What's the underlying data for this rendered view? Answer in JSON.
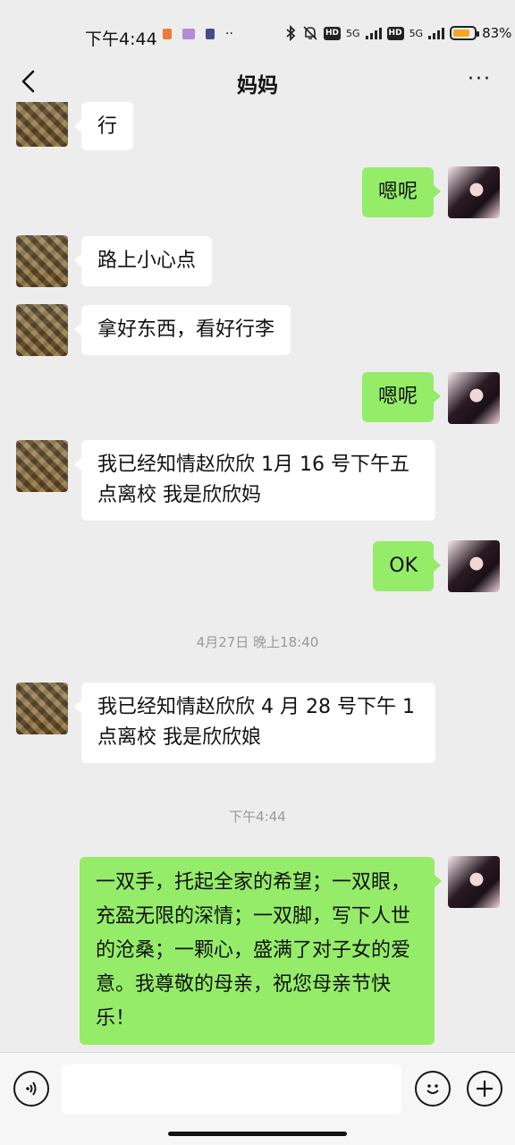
{
  "status_bar": {
    "time": "下午4:44",
    "net1": "5G",
    "net2": "5G",
    "hd": "HD",
    "battery_pct_text": "83%",
    "battery_level": 0.83,
    "battery_color": "#f5a623"
  },
  "header": {
    "title": "妈妈",
    "more_label": "···"
  },
  "messages": [
    {
      "side": "left",
      "text": "行"
    },
    {
      "side": "right",
      "text": "嗯呢"
    },
    {
      "side": "left",
      "text": "路上小心点"
    },
    {
      "side": "left",
      "text": "拿好东西，看好行李"
    },
    {
      "side": "right",
      "text": "嗯呢"
    },
    {
      "side": "left",
      "text": "我已经知情赵欣欣 1月 16 号下午五点离校 我是欣欣妈"
    },
    {
      "side": "right",
      "text": "OK"
    },
    {
      "side": "left",
      "text": "我已经知情赵欣欣 4 月 28 号下午 1 点离校 我是欣欣娘"
    },
    {
      "side": "right",
      "text": "一双手，托起全家的希望；一双眼，充盈无限的深情；一双脚，写下人世的沧桑；一颗心，盛满了对子女的爱意。我尊敬的母亲，祝您母亲节快乐！"
    }
  ],
  "timestamps": [
    "4月27日 晚上18:40",
    "下午4:44"
  ],
  "input": {
    "value": ""
  },
  "colors": {
    "bubble_right": "#95ec69",
    "bubble_left": "#ffffff",
    "background": "#ededed"
  }
}
